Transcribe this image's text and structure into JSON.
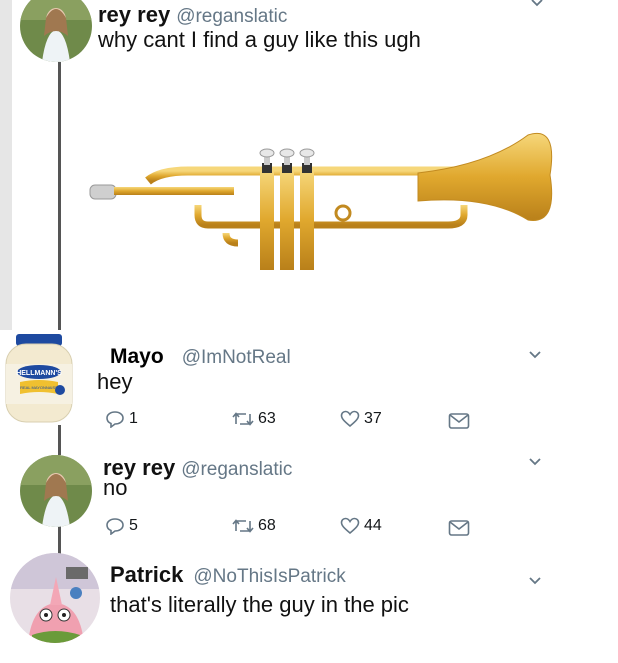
{
  "tweets": [
    {
      "name": "rey rey",
      "handle": "@reganslatic",
      "text": "why cant I find a guy like this ugh"
    },
    {
      "name": "Mayo",
      "handle": "@ImNotReal",
      "text": "hey",
      "replies": "1",
      "retweets": "63",
      "likes": "37"
    },
    {
      "name": "rey rey",
      "handle": "@reganslatic",
      "text": "no",
      "replies": "5",
      "retweets": "68",
      "likes": "44"
    },
    {
      "name": "Patrick",
      "handle": "@NoThisIsPatrick",
      "text": "that's literally the guy in the pic"
    }
  ],
  "mayo_jar": {
    "brand": "HELLMANN'S",
    "product": "REAL MAYONNAISE"
  },
  "colors": {
    "meta": "#657786",
    "trumpet": "#e0a82e",
    "thread": "#555555"
  }
}
